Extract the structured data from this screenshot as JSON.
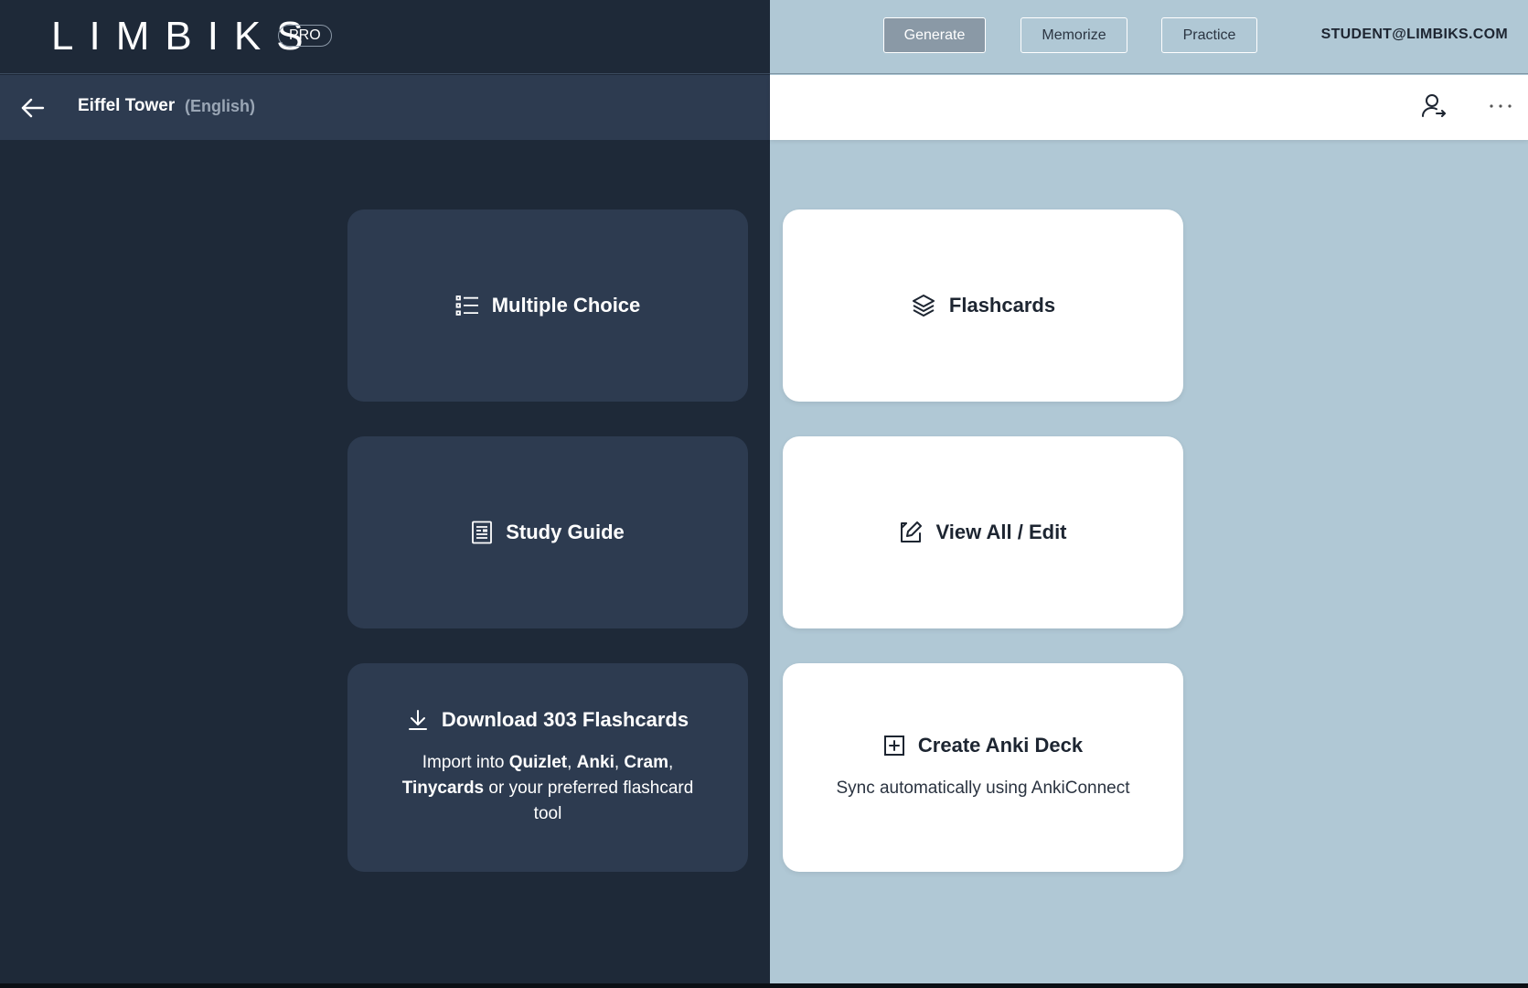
{
  "brand": {
    "logo": "LIMBIKS",
    "badge": "PRO"
  },
  "modes": {
    "generate": "Generate",
    "memorize": "Memorize",
    "practice": "Practice",
    "active": "Generate"
  },
  "user": {
    "email": "STUDENT@LIMBIKS.COM"
  },
  "deck": {
    "title": "Eiffel Tower",
    "language": "(English)"
  },
  "icons": {
    "back": "arrow-left-icon",
    "share": "user-share-icon",
    "more": "ellipsis-icon",
    "multiple_choice": "list-icon",
    "flashcards": "layers-icon",
    "study_guide": "document-icon",
    "view_all": "edit-icon",
    "download": "download-icon",
    "anki": "plus-square-icon"
  },
  "colors": {
    "left_bg": "#1e2938",
    "card_dark": "#2d3b50",
    "right_bg": "#b0c8d5",
    "card_light": "#ffffff",
    "active_button": "#8a99a6"
  },
  "cards": {
    "multiple_choice": {
      "title": "Multiple Choice"
    },
    "flashcards": {
      "title": "Flashcards"
    },
    "study_guide": {
      "title": "Study Guide"
    },
    "view_all": {
      "title": "View All / Edit"
    },
    "download": {
      "title": "Download 303 Flashcards",
      "desc_prefix": "Import into ",
      "quizlet": "Quizlet",
      "sep1": ", ",
      "anki": "Anki",
      "sep2": ", ",
      "cram": "Cram",
      "sep3": ",",
      "tinycards": "Tinycards",
      "desc_suffix": " or your preferred flashcard tool"
    },
    "anki": {
      "title": "Create Anki Deck",
      "desc": "Sync automatically using AnkiConnect"
    }
  }
}
